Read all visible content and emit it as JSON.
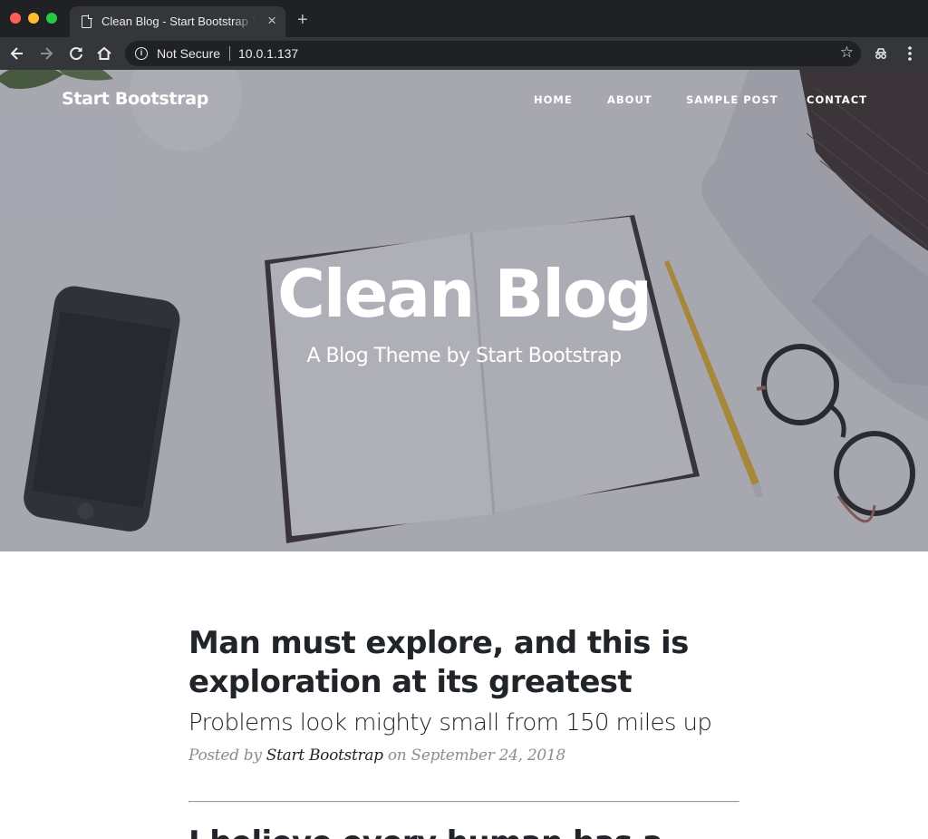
{
  "browser": {
    "tab_title": "Clean Blog - Start Bootstrap Theme",
    "tab_close": "×",
    "new_tab": "+",
    "security_label": "Not Secure",
    "url": "10.0.1.137"
  },
  "site": {
    "brand": "Start Bootstrap",
    "nav": [
      "HOME",
      "ABOUT",
      "SAMPLE POST",
      "CONTACT"
    ],
    "hero_title": "Clean Blog",
    "hero_subtitle": "A Blog Theme by Start Bootstrap"
  },
  "posts": [
    {
      "title_line1": "Man must explore, and this is",
      "title_line2": "exploration at its greatest",
      "subtitle": "Problems look mighty small from 150 miles up",
      "meta_prefix": "Posted by ",
      "author": "Start Bootstrap",
      "meta_on": " on ",
      "date": "September 24, 2018"
    },
    {
      "title_line1": "I believe every human has a"
    }
  ],
  "colors": {
    "chrome_dark": "#202124",
    "chrome_toolbar": "#35363a",
    "text_primary": "#212529",
    "text_muted": "#868e96"
  },
  "icons": [
    "back-icon",
    "forward-icon",
    "reload-icon",
    "home-icon",
    "info-icon",
    "star-icon",
    "incognito-icon",
    "menu-icon",
    "document-icon"
  ]
}
